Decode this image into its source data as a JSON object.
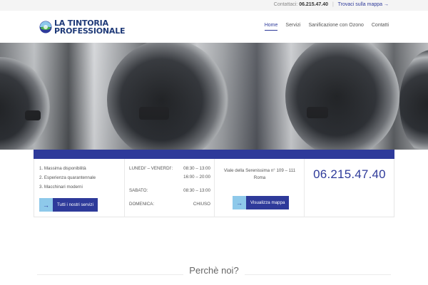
{
  "topbar": {
    "contact_label": "Contattaci:",
    "phone": "06.215.47.40",
    "map_link": "Trovaci sulla mappa →"
  },
  "logo": {
    "line1": "LA TINTORIA",
    "line2": "PROFESSIONALE"
  },
  "nav": {
    "items": [
      {
        "label": "Home",
        "active": true
      },
      {
        "label": "Servizi"
      },
      {
        "label": "Sanificazione con Ozono"
      },
      {
        "label": "Contatti"
      }
    ]
  },
  "info": {
    "features": [
      "1.  Massima disponibilità",
      "2.  Esperienza quarantennale",
      "3.  Macchinari moderni"
    ],
    "services_button": "Tutti i nostri servizi",
    "hours": [
      {
        "day": "LUNEDI' – VENERDI':",
        "time": "08:30 – 13:00"
      },
      {
        "day": "",
        "time": "16:00 – 20:00"
      },
      {
        "day": "SABATO:",
        "time": "08:30 – 13:00"
      },
      {
        "day": "DOMENICA:",
        "time": "CHIUSO"
      }
    ],
    "address_line1": "Viale della Serenissima n° 109 – 111",
    "address_line2": "Roma",
    "map_button": "Visualizza mappa",
    "phone": "06.215.47.40"
  },
  "section": {
    "title": "Perchè noi?"
  },
  "colors": {
    "brand": "#2e3a9a",
    "accent": "#8ec9ea"
  }
}
